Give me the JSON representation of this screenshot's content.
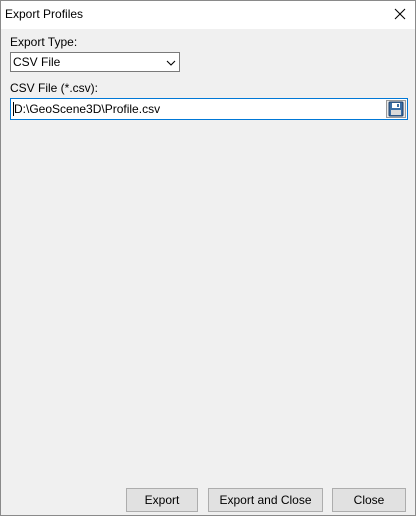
{
  "window": {
    "title": "Export Profiles",
    "close_icon": "close-icon"
  },
  "export_type": {
    "label": "Export Type:",
    "selected": "CSV File",
    "dropdown_icon": "chevron-down-icon"
  },
  "csv_file": {
    "label": "CSV File (*.csv):",
    "value": "D:\\GeoScene3D\\Profile.csv",
    "browse_icon": "floppy-disk-save-icon"
  },
  "buttons": {
    "export": "Export",
    "export_and_close": "Export and Close",
    "close": "Close"
  }
}
